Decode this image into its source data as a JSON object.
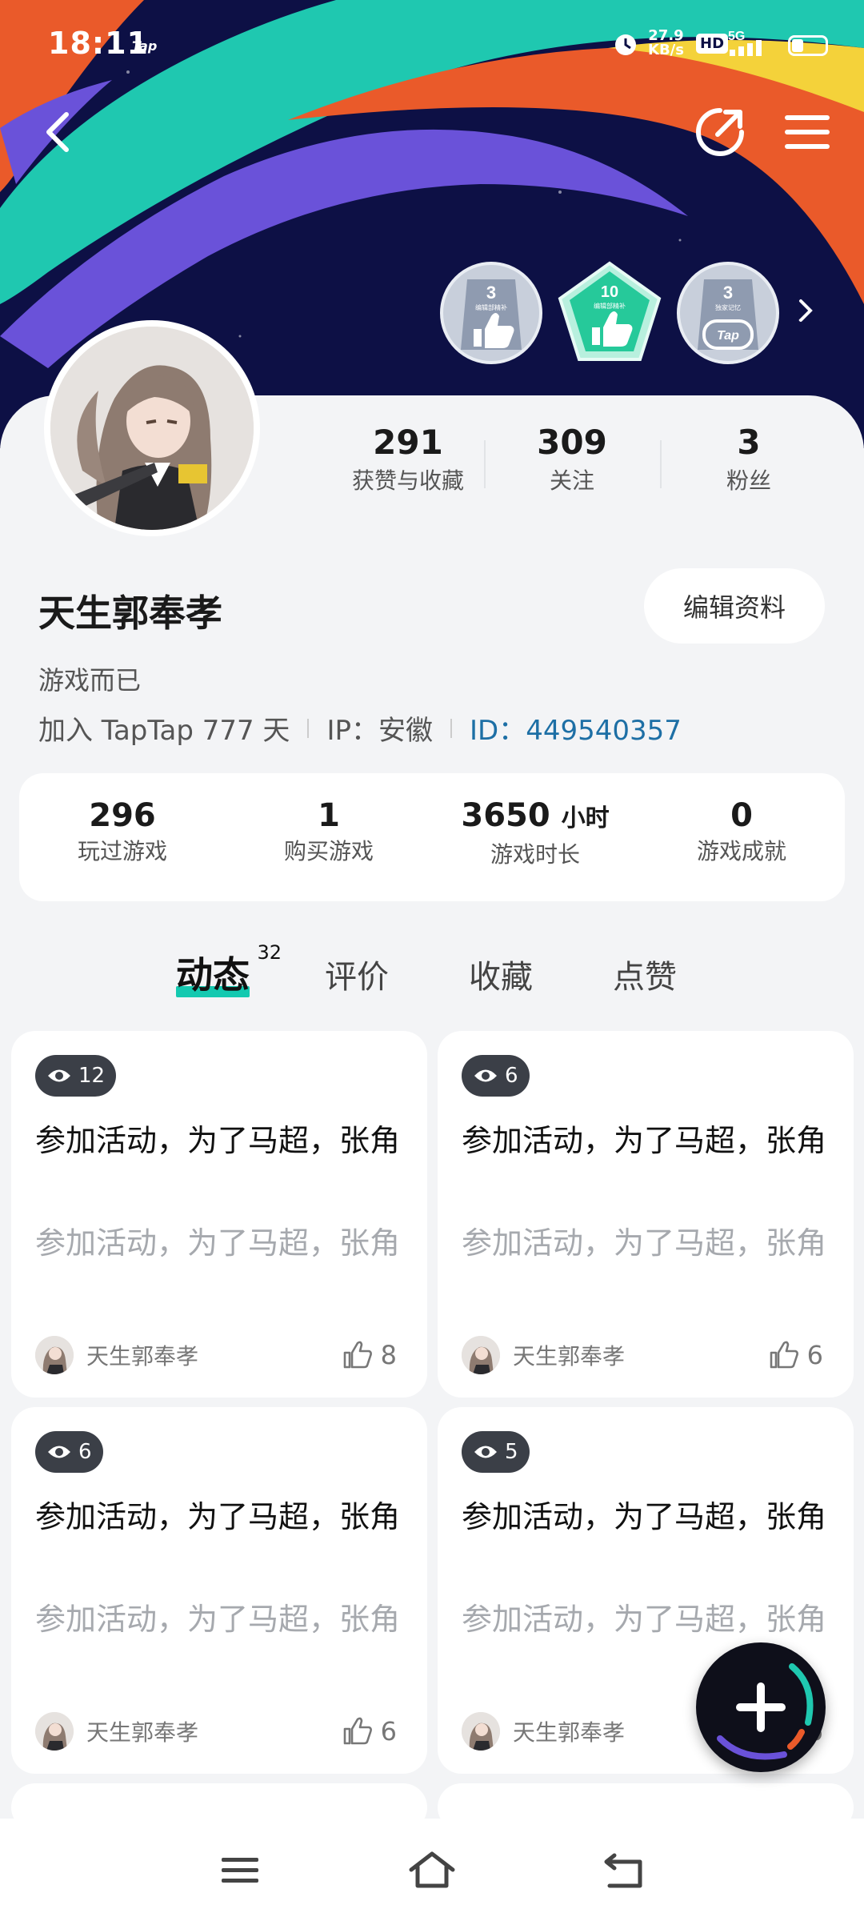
{
  "status_bar": {
    "time": "18:11",
    "app_mini": "Tap",
    "speed_value": "27.9",
    "speed_unit": "KB/s",
    "hd": "HD",
    "network": "5G",
    "battery_level": 0.35
  },
  "banner": {
    "colors": [
      "#0d1045",
      "#1fc8b0",
      "#ea5a2a",
      "#6a52d9",
      "#f4d23a"
    ],
    "badges": [
      {
        "level": "3",
        "caption": "编辑部精补",
        "color": "#8f9bb0",
        "icon": "thumb-up-icon",
        "shape": "circle"
      },
      {
        "level": "10",
        "caption": "编辑部精补",
        "color": "#26c99a",
        "icon": "thumb-up-icon",
        "shape": "pentagon"
      },
      {
        "level": "3",
        "caption": "独家记忆",
        "color": "#8f9bb0",
        "icon": "gamepad-icon",
        "shape": "circle",
        "inner": "Tap"
      }
    ]
  },
  "profile": {
    "stats": [
      {
        "value": "291",
        "label": "获赞与收藏"
      },
      {
        "value": "309",
        "label": "关注"
      },
      {
        "value": "3",
        "label": "粉丝"
      }
    ],
    "username": "天生郭奉孝",
    "edit_label": "编辑资料",
    "bio": "游戏而已",
    "joined": "加入 TapTap 777 天",
    "ip": "IP：安徽",
    "id_label": "ID：",
    "id_value": "449540357"
  },
  "game_stats": [
    {
      "value": "296",
      "unit": "",
      "label": "玩过游戏"
    },
    {
      "value": "1",
      "unit": "",
      "label": "购买游戏"
    },
    {
      "value": "3650",
      "unit": "小时",
      "label": "游戏时长"
    },
    {
      "value": "0",
      "unit": "",
      "label": "游戏成就"
    }
  ],
  "tabs": [
    {
      "label": "动态",
      "count": "32",
      "active": true
    },
    {
      "label": "评价",
      "active": false
    },
    {
      "label": "收藏",
      "active": false
    },
    {
      "label": "点赞",
      "active": false
    }
  ],
  "posts": [
    {
      "views": "12",
      "title": "参加活动，为了马超，张角",
      "body": "参加活动，为了马超，张角",
      "author": "天生郭奉孝",
      "likes": "8"
    },
    {
      "views": "6",
      "title": "参加活动，为了马超，张角",
      "body": "参加活动，为了马超，张角",
      "author": "天生郭奉孝",
      "likes": "6"
    },
    {
      "views": "6",
      "title": "参加活动，为了马超，张角",
      "body": "参加活动，为了马超，张角",
      "author": "天生郭奉孝",
      "likes": "6"
    },
    {
      "views": "5",
      "title": "参加活动，为了马超，张角",
      "body": "参加活动，为了马超，张角",
      "author": "天生郭奉孝",
      "likes": "6"
    }
  ]
}
